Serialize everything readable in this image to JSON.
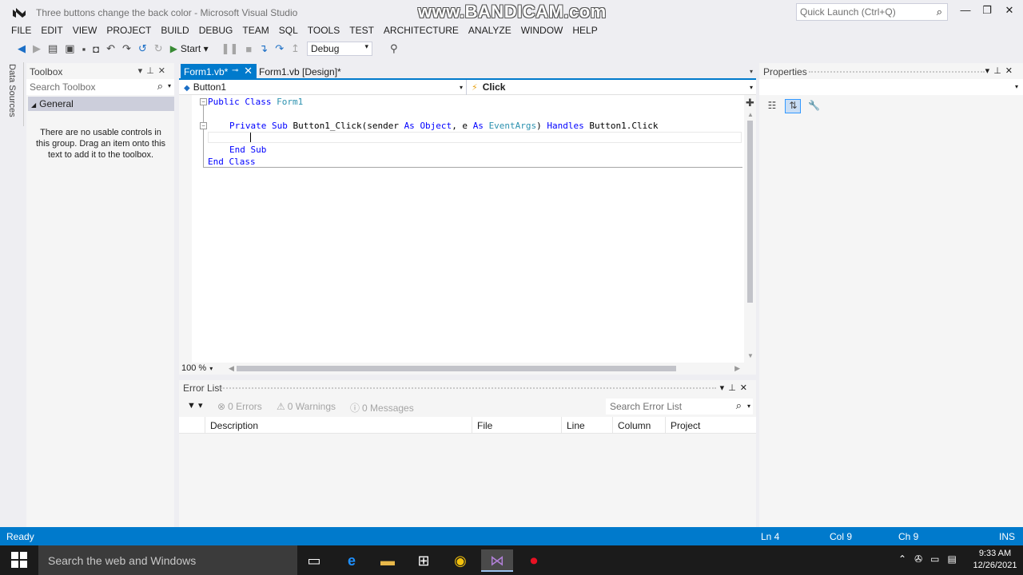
{
  "window": {
    "title": "Three buttons change the back color - Microsoft Visual Studio",
    "watermark": "www.BANDICAM.com",
    "quick_launch_placeholder": "Quick Launch (Ctrl+Q)"
  },
  "menu": [
    "FILE",
    "EDIT",
    "VIEW",
    "PROJECT",
    "BUILD",
    "DEBUG",
    "TEAM",
    "SQL",
    "TOOLS",
    "TEST",
    "ARCHITECTURE",
    "ANALYZE",
    "WINDOW",
    "HELP"
  ],
  "toolbar": {
    "start_label": "Start",
    "configuration": "Debug"
  },
  "side_tab": "Data Sources",
  "toolbox": {
    "title": "Toolbox",
    "search_placeholder": "Search Toolbox",
    "group": "General",
    "empty_message": "There are no usable controls in this group. Drag an item onto this text to add it to the toolbox."
  },
  "tabs": {
    "active": "Form1.vb*",
    "design": "Form1.vb [Design]*"
  },
  "navbar": {
    "object": "Button1",
    "event": "Click"
  },
  "code": {
    "line1": {
      "kw": "Public Class ",
      "name": "Form1"
    },
    "line2": {
      "kw1": "Private Sub ",
      "t1": "Button1_Click(sender ",
      "kw2": "As ",
      "kw3": "Object",
      "t2": ", e ",
      "kw4": "As ",
      "type": "EventArgs",
      "t3": ") ",
      "kw5": "Handles ",
      "t4": "Button1.Click"
    },
    "line3": "End Sub",
    "line4": "End Class"
  },
  "editor": {
    "zoom": "100 %"
  },
  "error_list": {
    "title": "Error List",
    "errors": "0 Errors",
    "warnings": "0 Warnings",
    "messages": "0 Messages",
    "search_placeholder": "Search Error List",
    "columns": [
      "Description",
      "File",
      "Line",
      "Column",
      "Project"
    ]
  },
  "properties": {
    "title": "Properties"
  },
  "status": {
    "ready": "Ready",
    "ln": "Ln 4",
    "col": "Col 9",
    "ch": "Ch 9",
    "mode": "INS"
  },
  "taskbar": {
    "search_placeholder": "Search the web and Windows",
    "time": "9:33 AM",
    "date": "12/26/2021"
  },
  "colors": {
    "accent": "#007acc",
    "keyword": "#0000ff",
    "type": "#2b91af"
  }
}
